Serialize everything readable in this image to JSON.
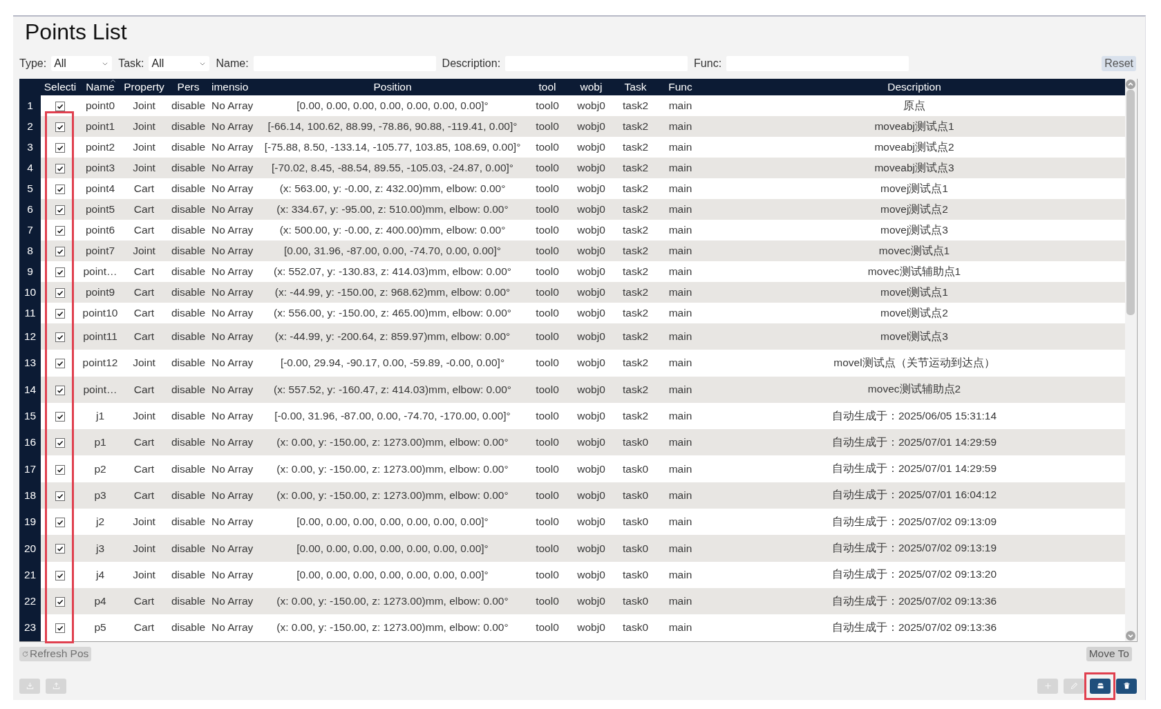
{
  "title": "Points List",
  "filters": [
    {
      "kind": "select",
      "label": "Type:",
      "value": "All"
    },
    {
      "kind": "select",
      "label": "Task:",
      "value": "All"
    },
    {
      "kind": "text",
      "label": "Name:"
    },
    {
      "kind": "text",
      "label": "Description:"
    },
    {
      "kind": "text",
      "label": "Func:"
    }
  ],
  "reset_button": "Reset",
  "table": {
    "selection_column": {
      "label": "Selecti",
      "outlined": true
    },
    "columns": [
      {
        "label": "Name",
        "sorted": true
      },
      {
        "label": "Property",
        "sorted": false
      },
      {
        "label": "Pers",
        "sorted": false
      },
      {
        "label": "imensio",
        "sorted": false
      },
      {
        "label": "Position",
        "sorted": false
      },
      {
        "label": "tool",
        "sorted": false
      },
      {
        "label": "wobj",
        "sorted": false
      },
      {
        "label": "Task",
        "sorted": false
      },
      {
        "label": "Func",
        "sorted": false
      },
      {
        "label": "Description",
        "sorted": false
      }
    ],
    "rows": [
      {
        "number": "1",
        "checked": true,
        "cells": [
          "point0",
          "Joint",
          "disable",
          "No Array",
          "[0.00, 0.00, 0.00, 0.00, 0.00, 0.00, 0.00]°",
          "tool0",
          "wobj0",
          "task2",
          "main",
          "原点"
        ]
      },
      {
        "number": "2",
        "checked": true,
        "cells": [
          "point1",
          "Joint",
          "disable",
          "No Array",
          "[-66.14, 100.62, 88.99, -78.86, 90.88, -119.41, 0.00]°",
          "tool0",
          "wobj0",
          "task2",
          "main",
          "moveabj测试点1"
        ]
      },
      {
        "number": "3",
        "checked": true,
        "cells": [
          "point2",
          "Joint",
          "disable",
          "No Array",
          "[-75.88, 8.50, -133.14, -105.77, 103.85, 108.69, 0.00]°",
          "tool0",
          "wobj0",
          "task2",
          "main",
          "moveabj测试点2"
        ]
      },
      {
        "number": "4",
        "checked": true,
        "cells": [
          "point3",
          "Joint",
          "disable",
          "No Array",
          "[-70.02, 8.45, -88.54, 89.55, -105.03, -24.87, 0.00]°",
          "tool0",
          "wobj0",
          "task2",
          "main",
          "moveabj测试点3"
        ]
      },
      {
        "number": "5",
        "checked": true,
        "cells": [
          "point4",
          "Cart",
          "disable",
          "No Array",
          "(x: 563.00, y: -0.00, z: 432.00)mm, elbow: 0.00°",
          "tool0",
          "wobj0",
          "task2",
          "main",
          "movej测试点1"
        ]
      },
      {
        "number": "6",
        "checked": true,
        "cells": [
          "point5",
          "Cart",
          "disable",
          "No Array",
          "(x: 334.67, y: -95.00, z: 510.00)mm, elbow: 0.00°",
          "tool0",
          "wobj0",
          "task2",
          "main",
          "movej测试点2"
        ]
      },
      {
        "number": "7",
        "checked": true,
        "cells": [
          "point6",
          "Cart",
          "disable",
          "No Array",
          "(x: 500.00, y: -0.00, z: 400.00)mm, elbow: 0.00°",
          "tool0",
          "wobj0",
          "task2",
          "main",
          "movej测试点3"
        ]
      },
      {
        "number": "8",
        "checked": true,
        "cells": [
          "point7",
          "Joint",
          "disable",
          "No Array",
          "[0.00, 31.96, -87.00, 0.00, -74.70, 0.00, 0.00]°",
          "tool0",
          "wobj0",
          "task2",
          "main",
          "movec测试点1"
        ]
      },
      {
        "number": "9",
        "checked": true,
        "cells": [
          "point…",
          "Cart",
          "disable",
          "No Array",
          "(x: 552.07, y: -130.83, z: 414.03)mm, elbow: 0.00°",
          "tool0",
          "wobj0",
          "task2",
          "main",
          "movec测试辅助点1"
        ]
      },
      {
        "number": "10",
        "checked": true,
        "cells": [
          "point9",
          "Cart",
          "disable",
          "No Array",
          "(x: -44.99, y: -150.00, z: 968.62)mm, elbow: 0.00°",
          "tool0",
          "wobj0",
          "task2",
          "main",
          "movel测试点1"
        ]
      },
      {
        "number": "11",
        "checked": true,
        "cells": [
          "point10",
          "Cart",
          "disable",
          "No Array",
          "(x: 556.00, y: -150.00, z: 465.00)mm, elbow: 0.00°",
          "tool0",
          "wobj0",
          "task2",
          "main",
          "movel测试点2"
        ]
      },
      {
        "number": "12",
        "checked": true,
        "cells": [
          "point11",
          "Cart",
          "disable",
          "No Array",
          "(x: -44.99, y: -200.64, z: 859.97)mm, elbow: 0.00°",
          "tool0",
          "wobj0",
          "task2",
          "main",
          "movel测试点3"
        ]
      },
      {
        "number": "13",
        "checked": true,
        "cells": [
          "point12",
          "Joint",
          "disable",
          "No Array",
          "[-0.00, 29.94, -90.17, 0.00, -59.89, -0.00, 0.00]°",
          "tool0",
          "wobj0",
          "task2",
          "main",
          "movel测试点（关节运动到达点）"
        ]
      },
      {
        "number": "14",
        "checked": true,
        "cells": [
          "point…",
          "Cart",
          "disable",
          "No Array",
          "(x: 557.52, y: -160.47, z: 414.03)mm, elbow: 0.00°",
          "tool0",
          "wobj0",
          "task2",
          "main",
          "movec测试辅助点2"
        ]
      },
      {
        "number": "15",
        "checked": true,
        "cells": [
          "j1",
          "Joint",
          "disable",
          "No Array",
          "[-0.00, 31.96, -87.00, 0.00, -74.70, -170.00, 0.00]°",
          "tool0",
          "wobj0",
          "task2",
          "main",
          "自动生成于：2025/06/05 15:31:14"
        ]
      },
      {
        "number": "16",
        "checked": true,
        "cells": [
          "p1",
          "Cart",
          "disable",
          "No Array",
          "(x: 0.00, y: -150.00, z: 1273.00)mm, elbow: 0.00°",
          "tool0",
          "wobj0",
          "task0",
          "main",
          "自动生成于：2025/07/01 14:29:59"
        ]
      },
      {
        "number": "17",
        "checked": true,
        "cells": [
          "p2",
          "Cart",
          "disable",
          "No Array",
          "(x: 0.00, y: -150.00, z: 1273.00)mm, elbow: 0.00°",
          "tool0",
          "wobj0",
          "task0",
          "main",
          "自动生成于：2025/07/01 14:29:59"
        ]
      },
      {
        "number": "18",
        "checked": true,
        "cells": [
          "p3",
          "Cart",
          "disable",
          "No Array",
          "(x: 0.00, y: -150.00, z: 1273.00)mm, elbow: 0.00°",
          "tool0",
          "wobj0",
          "task0",
          "main",
          "自动生成于：2025/07/01 16:04:12"
        ]
      },
      {
        "number": "19",
        "checked": true,
        "cells": [
          "j2",
          "Joint",
          "disable",
          "No Array",
          "[0.00, 0.00, 0.00, 0.00, 0.00, 0.00, 0.00]°",
          "tool0",
          "wobj0",
          "task0",
          "main",
          "自动生成于：2025/07/02 09:13:09"
        ]
      },
      {
        "number": "20",
        "checked": true,
        "cells": [
          "j3",
          "Joint",
          "disable",
          "No Array",
          "[0.00, 0.00, 0.00, 0.00, 0.00, 0.00, 0.00]°",
          "tool0",
          "wobj0",
          "task0",
          "main",
          "自动生成于：2025/07/02 09:13:19"
        ]
      },
      {
        "number": "21",
        "checked": true,
        "cells": [
          "j4",
          "Joint",
          "disable",
          "No Array",
          "[0.00, 0.00, 0.00, 0.00, 0.00, 0.00, 0.00]°",
          "tool0",
          "wobj0",
          "task0",
          "main",
          "自动生成于：2025/07/02 09:13:20"
        ]
      },
      {
        "number": "22",
        "checked": true,
        "cells": [
          "p4",
          "Cart",
          "disable",
          "No Array",
          "(x: 0.00, y: -150.00, z: 1273.00)mm, elbow: 0.00°",
          "tool0",
          "wobj0",
          "task0",
          "main",
          "自动生成于：2025/07/02 09:13:36"
        ]
      },
      {
        "number": "23",
        "checked": true,
        "cells": [
          "p5",
          "Cart",
          "disable",
          "No Array",
          "(x: 0.00, y: -150.00, z: 1273.00)mm, elbow: 0.00°",
          "tool0",
          "wobj0",
          "task0",
          "main",
          "自动生成于：2025/07/02 09:13:36"
        ]
      }
    ]
  },
  "refresh_button": "Refresh Pos",
  "move_to_button": "Move To",
  "bottom_left_buttons": [
    {
      "kind": "download",
      "disabled": true
    },
    {
      "kind": "upload",
      "disabled": true
    }
  ],
  "bottom_right_buttons": [
    {
      "kind": "add",
      "disabled": true,
      "outlined": false
    },
    {
      "kind": "edit",
      "disabled": true,
      "outlined": false
    },
    {
      "kind": "tray",
      "disabled": false,
      "outlined": true
    },
    {
      "kind": "delete",
      "disabled": false,
      "outlined": false
    }
  ]
}
